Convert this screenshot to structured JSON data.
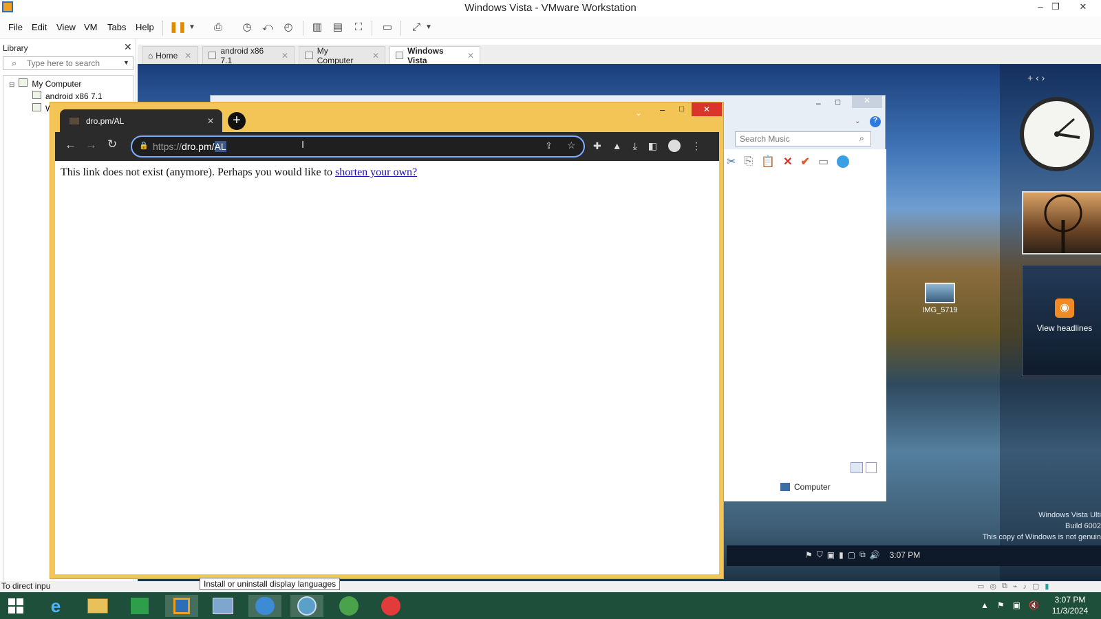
{
  "window": {
    "title": "Windows Vista - VMware Workstation"
  },
  "menu": {
    "file": "File",
    "edit": "Edit",
    "view": "View",
    "vm": "VM",
    "tabs": "Tabs",
    "help": "Help"
  },
  "library": {
    "title": "Library",
    "search_placeholder": "Type here to search",
    "tree": {
      "root": "My Computer",
      "items": [
        "android x86 7.1",
        "W"
      ]
    }
  },
  "vm_tabs": [
    {
      "label": "Home"
    },
    {
      "label": "android x86 7.1"
    },
    {
      "label": "My Computer"
    },
    {
      "label": "Windows Vista"
    }
  ],
  "guest": {
    "explorer": {
      "search_placeholder": "Search Music",
      "status": "Computer"
    },
    "chrome": {
      "tab_title": "dro.pm/AL",
      "url_scheme": "https://",
      "url_host": "dro.pm/",
      "url_path_selected": "AL",
      "page_message": "This link does not exist (anymore). Perhaps you would like to ",
      "page_link": "shorten your own?"
    },
    "desktop_icon": {
      "label": "IMG_5719"
    },
    "gadgets": {
      "headlines": "View headlines"
    },
    "watermark": {
      "line1": "Windows Vista Ulti",
      "line2": "Build 6002",
      "line3": "This copy of Windows is not genuin"
    },
    "time": "3:07 PM"
  },
  "status_bar": {
    "left_text": "To direct inpu"
  },
  "tooltip": "Install or uninstall display languages",
  "host_clock": {
    "time": "3:07 PM",
    "date": "11/3/2024"
  },
  "colors": {
    "chrome_frame": "#f3c456",
    "accent": "#7fb0ff",
    "taskbar": "#1e4f3a"
  }
}
